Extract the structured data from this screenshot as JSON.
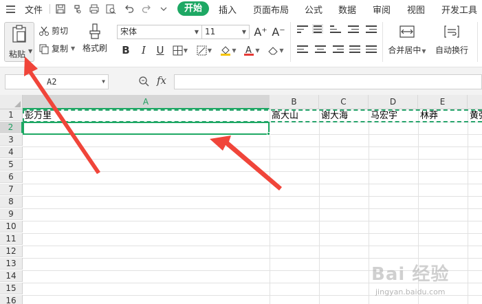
{
  "menubar": {
    "file_label": "文件",
    "tabs": [
      "开始",
      "插入",
      "页面布局",
      "公式",
      "数据",
      "审阅",
      "视图",
      "开发工具"
    ],
    "active_tab": "开始"
  },
  "ribbon": {
    "paste_label": "粘贴",
    "cut_label": "剪切",
    "copy_label": "复制",
    "format_painter_label": "格式刷",
    "font_name": "宋体",
    "font_size": "11",
    "merge_label": "合并居中",
    "wrap_label": "自动换行",
    "grow_font": "A⁺",
    "shrink_font": "A⁻"
  },
  "formula_bar": {
    "name_box": "A2",
    "fx_label": "fx",
    "formula": ""
  },
  "grid": {
    "columns": [
      "A",
      "B",
      "C",
      "D",
      "E"
    ],
    "selected_column": "A",
    "rows": [
      "1",
      "2",
      "3",
      "4",
      "5",
      "6",
      "7",
      "8",
      "9",
      "10",
      "11",
      "12",
      "13",
      "14",
      "15",
      "16"
    ],
    "selected_row": "2",
    "row1_values": [
      "彭万里",
      "高大山",
      "谢大海",
      "马宏宇",
      "林莽",
      "黄强"
    ]
  },
  "watermark": {
    "text": "Bai 经验",
    "url": "jingyan.baidu.com"
  },
  "colors": {
    "accent": "#1ea864",
    "arrow": "#f0453a"
  }
}
